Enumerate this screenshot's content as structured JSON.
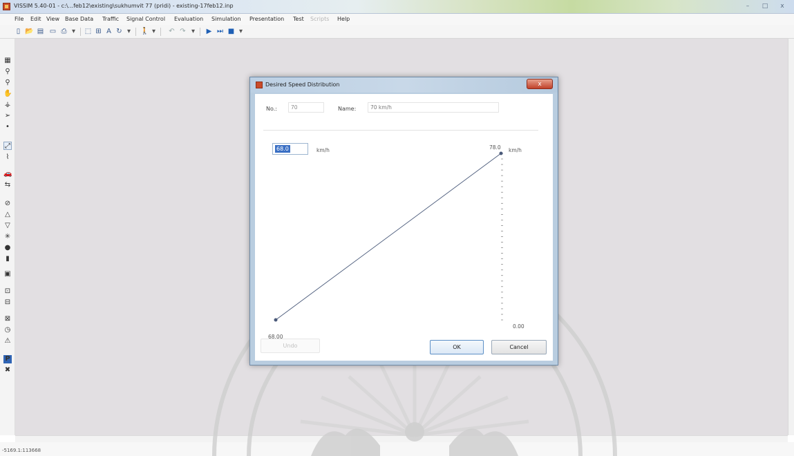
{
  "window": {
    "title": "VISSIM 5.40-01 - c:\\...feb12\\existing\\sukhumvit 77 (pridi) - existing-17feb12.inp",
    "min_glyph": "–",
    "max_glyph": "□",
    "close_glyph": "x"
  },
  "menu": {
    "items": [
      {
        "label": "File",
        "dim": false
      },
      {
        "label": "Edit",
        "dim": false
      },
      {
        "label": "View",
        "dim": false
      },
      {
        "label": "Base Data",
        "dim": false
      },
      {
        "label": "Traffic",
        "dim": false
      },
      {
        "label": "Signal Control",
        "dim": false
      },
      {
        "label": "Evaluation",
        "dim": false
      },
      {
        "label": "Simulation",
        "dim": false
      },
      {
        "label": "Presentation",
        "dim": false
      },
      {
        "label": "Test",
        "dim": false
      },
      {
        "label": "Scripts",
        "dim": true
      },
      {
        "label": "Help",
        "dim": false
      }
    ]
  },
  "toolbar": {
    "buttons": [
      {
        "name": "new-icon",
        "glyph": "▯"
      },
      {
        "name": "open-icon",
        "glyph": "📂"
      },
      {
        "name": "save-icon",
        "glyph": "▤"
      },
      {
        "name": "print-preview-icon",
        "glyph": "▭"
      },
      {
        "name": "print-icon",
        "glyph": "⎙"
      },
      {
        "name": "dropdown-icon",
        "glyph": "▾"
      },
      {
        "name": "select-icon",
        "glyph": "⬚"
      },
      {
        "name": "selection-mode-icon",
        "glyph": "⊞"
      },
      {
        "name": "text-tool-icon",
        "glyph": "A"
      },
      {
        "name": "rotate-icon",
        "glyph": "↻"
      },
      {
        "name": "dropdown-icon",
        "glyph": "▾"
      },
      {
        "name": "pedestrian-icon",
        "glyph": "🚶"
      },
      {
        "name": "dropdown-icon",
        "glyph": "▾"
      },
      {
        "name": "undo-icon",
        "glyph": "↶"
      },
      {
        "name": "redo-icon",
        "glyph": "↷"
      },
      {
        "name": "dropdown-icon",
        "glyph": "▾"
      },
      {
        "name": "play-icon",
        "glyph": "▶"
      },
      {
        "name": "step-icon",
        "glyph": "⏭"
      },
      {
        "name": "stop-icon",
        "glyph": "■"
      },
      {
        "name": "dropdown-icon",
        "glyph": "▾"
      }
    ]
  },
  "left_toolbar": {
    "buttons": [
      {
        "name": "network-icon",
        "glyph": "▦",
        "color": "#3a5a8c"
      },
      {
        "name": "zoom-in-icon",
        "glyph": "⚲",
        "color": "#3a5a8c"
      },
      {
        "name": "zoom-out-icon",
        "glyph": "⚲",
        "color": "#3a5a8c"
      },
      {
        "name": "pan-icon",
        "glyph": "✋",
        "color": "#3a5a8c"
      },
      {
        "name": "pin-icon",
        "glyph": "⚶",
        "color": "#6a6a6a"
      },
      {
        "name": "arrow-tool-icon",
        "glyph": "➢",
        "color": "#6a6a6a"
      },
      {
        "name": "dot-icon",
        "glyph": "•",
        "color": "#6a6a6a"
      },
      {
        "name": "links-tool-icon",
        "glyph": "⤢",
        "color": "#3a5a8c"
      },
      {
        "name": "link-icon",
        "glyph": "⌇",
        "color": "#8a8a8a"
      },
      {
        "name": "vehicle-input-icon",
        "glyph": "🚗",
        "color": "#3a5a8c"
      },
      {
        "name": "routing-icon",
        "glyph": "⇆",
        "color": "#3a5a8c"
      },
      {
        "name": "stop-sign-icon",
        "glyph": "⊘",
        "color": "#cc2a2a"
      },
      {
        "name": "warning-icon",
        "glyph": "△",
        "color": "#cc2a2a"
      },
      {
        "name": "priority-rule-icon",
        "glyph": "▽",
        "color": "#cc2a2a"
      },
      {
        "name": "conflict-area-icon",
        "glyph": "✳",
        "color": "#e0b000"
      },
      {
        "name": "signal-head-icon",
        "glyph": "●",
        "color": "#cc2a2a"
      },
      {
        "name": "signal-icon",
        "glyph": "▮",
        "color": "#2a8c2a"
      },
      {
        "name": "detector-icon",
        "glyph": "▣",
        "color": "#3a5a8c"
      },
      {
        "name": "transit-stop-icon",
        "glyph": "⊡",
        "color": "#3a5a8c"
      },
      {
        "name": "bus-icon",
        "glyph": "⊟",
        "color": "#3a5a8c"
      },
      {
        "name": "nodes-icon",
        "glyph": "⊠",
        "color": "#3a5a8c"
      },
      {
        "name": "clock-icon",
        "glyph": "◷",
        "color": "#3a5a8c"
      },
      {
        "name": "hazard-icon",
        "glyph": "⚠",
        "color": "#cc2a2a"
      },
      {
        "name": "parking-icon",
        "glyph": "P",
        "color": "#ffffff"
      },
      {
        "name": "evaluation-icon",
        "glyph": "✖",
        "color": "#2b2b2b"
      }
    ]
  },
  "dialog": {
    "title": "Desired Speed Distribution",
    "close_label": "x",
    "no_label": "No.:",
    "no_value": "70",
    "name_label": "Name:",
    "name_value": "70 km/h",
    "speed_input_value": "68.0",
    "left_unit": "km/h",
    "right_unit": "km/h",
    "max_value": "78.0",
    "min_value": "68.00",
    "zero_label": "0.00",
    "undo_label": "Undo",
    "ok_label": "OK",
    "cancel_label": "Cancel"
  },
  "status": {
    "coords": "-5169.1:113668"
  },
  "chart_data": {
    "type": "line",
    "x": [
      68.0,
      78.0
    ],
    "y": [
      0.0,
      1.0
    ],
    "xlabel": "km/h",
    "xlim": [
      68.0,
      78.0
    ],
    "ylim": [
      0.0,
      1.0
    ]
  }
}
